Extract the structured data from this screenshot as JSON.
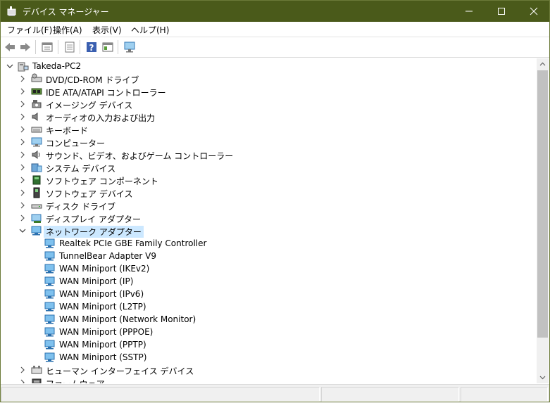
{
  "window": {
    "title": "デバイス マネージャー",
    "titlebar_color": "#4a5a1a"
  },
  "menu": [
    "ファイル(F)",
    "操作(A)",
    "表示(V)",
    "ヘルプ(H)"
  ],
  "toolbar": {
    "buttons": [
      "back-icon",
      "forward-icon",
      "properties-icon",
      "update-driver-icon",
      "help-icon",
      "view-icon",
      "monitor-icon"
    ]
  },
  "tree": {
    "root": "Takeda-PC2",
    "categories": [
      {
        "label": "DVD/CD-ROM ドライブ",
        "icon": "dvd-drive-icon"
      },
      {
        "label": "IDE ATA/ATAPI コントローラー",
        "icon": "ide-controller-icon"
      },
      {
        "label": "イメージング デバイス",
        "icon": "imaging-device-icon"
      },
      {
        "label": "オーディオの入力および出力",
        "icon": "speaker-icon"
      },
      {
        "label": "キーボード",
        "icon": "keyboard-icon"
      },
      {
        "label": "コンピューター",
        "icon": "computer-icon"
      },
      {
        "label": "サウンド、ビデオ、およびゲーム コントローラー",
        "icon": "sound-icon"
      },
      {
        "label": "システム デバイス",
        "icon": "system-device-icon"
      },
      {
        "label": "ソフトウェア コンポーネント",
        "icon": "software-component-icon"
      },
      {
        "label": "ソフトウェア デバイス",
        "icon": "software-device-icon"
      },
      {
        "label": "ディスク ドライブ",
        "icon": "disk-drive-icon"
      },
      {
        "label": "ディスプレイ アダプター",
        "icon": "display-adapter-icon"
      },
      {
        "label": "ネットワーク アダプター",
        "icon": "network-adapter-icon",
        "expanded": true,
        "selected": true
      }
    ],
    "network_adapters": [
      "Realtek PCIe GBE Family Controller",
      "TunnelBear Adapter V9",
      "WAN Miniport (IKEv2)",
      "WAN Miniport (IP)",
      "WAN Miniport (IPv6)",
      "WAN Miniport (L2TP)",
      "WAN Miniport (Network Monitor)",
      "WAN Miniport (PPPOE)",
      "WAN Miniport (PPTP)",
      "WAN Miniport (SSTP)"
    ],
    "after": [
      {
        "label": "ヒューマン インターフェイス デバイス",
        "icon": "hid-icon"
      },
      {
        "label": "ファームウェア",
        "icon": "firmware-icon"
      }
    ]
  }
}
